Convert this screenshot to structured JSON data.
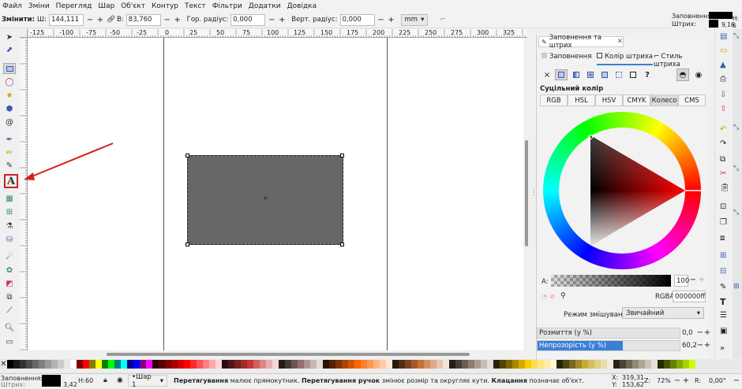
{
  "menu": [
    "Файл",
    "Зміни",
    "Перегляд",
    "Шар",
    "Об'єкт",
    "Контур",
    "Текст",
    "Фільтри",
    "Додатки",
    "Довідка"
  ],
  "toolbar": {
    "change_label": "Змінити:",
    "w_label": "Ш:",
    "w_value": "144,111",
    "h_label": "В:",
    "h_value": "83,760",
    "rx_label": "Гор. радіус:",
    "rx_value": "0,000",
    "ry_label": "Верт. радіус:",
    "ry_value": "0,000",
    "unit": "mm"
  },
  "fs_mini": {
    "fill_label": "Заповнення:",
    "stroke_label": "Штрих:",
    "stroke_width": "9,16",
    "h_label": "Н: 6"
  },
  "ruler_labels": [
    "-125",
    "-100",
    "-75",
    "-50",
    "-25",
    "0",
    "25",
    "50",
    "75",
    "100",
    "125",
    "150",
    "175",
    "200",
    "225",
    "250",
    "275",
    "300",
    "325"
  ],
  "dock": {
    "panel_tab": "Заповнення та штрих",
    "tabs": [
      "Заповнення",
      "Колір штриха",
      "Стиль штриха"
    ],
    "solid_label": "Суцільний колір",
    "modes": [
      "RGB",
      "HSL",
      "HSV",
      "CMYK",
      "Колесо",
      "CMS"
    ],
    "active_mode": "Колесо",
    "alpha_label": "A:",
    "alpha_value": "100",
    "rgba_label": "RGBA:",
    "rgba_value": "000000ff",
    "blend_label": "Режим змішування:",
    "blend_value": "Звичайний",
    "blur_label": "Розмиття (у %)",
    "blur_value": "0,0",
    "opacity_label": "Непрозорість (у %)",
    "opacity_value": "60,2",
    "opacity_fraction": 0.602
  },
  "status": {
    "fill_label": "Заповнення:",
    "stroke_label": "Штрих:",
    "stroke_value": "3,42",
    "h_label": "Н:",
    "h_value": "60",
    "layer": "•Шар 1",
    "message_b1": "Перетягування",
    "message_t1": " малює прямокутник. ",
    "message_b2": "Перетягування ручок",
    "message_t2": " змінює розмір та округляє кути. ",
    "message_b3": "Клацання",
    "message_t3": " позначає об'єкт.",
    "x_label": "X:",
    "x_value": "319,31",
    "y_label": "Y:",
    "y_value": "153,62",
    "z_label": "Z:",
    "zoom": "72%",
    "r_label": "R:",
    "rotation": "0,00°"
  },
  "colors": {
    "rect_fill": "#666666",
    "highlight": "#cc2222",
    "accent": "#3a7fd6"
  },
  "palette": [
    "#000000",
    "#1a1a1a",
    "#333333",
    "#4d4d4d",
    "#666666",
    "#808080",
    "#999999",
    "#b3b3b3",
    "#cccccc",
    "#e6e6e6",
    "#ffffff",
    "#800000",
    "#ff0000",
    "#808000",
    "#ffff00",
    "#008000",
    "#00ff00",
    "#008080",
    "#00ffff",
    "#000080",
    "#0000ff",
    "#800080",
    "#ff00ff",
    "#2b0000",
    "#550000",
    "#800000",
    "#aa0000",
    "#d40000",
    "#ff0000",
    "#ff2a2a",
    "#ff5555",
    "#ff8080",
    "#ffaaaa",
    "#ffd5d5",
    "#280b0b",
    "#501616",
    "#782121",
    "#a02c2c",
    "#c83737",
    "#d35f5f",
    "#de8787",
    "#e9afaf",
    "#f4d7d7",
    "#241c1c",
    "#483737",
    "#6c5353",
    "#916f6f",
    "#ac9393",
    "#c8b7b7",
    "#e3dbdb",
    "#2b1100",
    "#552200",
    "#803300",
    "#aa4400",
    "#d45500",
    "#ff6600",
    "#ff7f2a",
    "#ff9955",
    "#ffb380",
    "#ffccaa",
    "#ffe6d5",
    "#28170b",
    "#502d16",
    "#784421",
    "#a05a2c",
    "#c87137",
    "#d38d5f",
    "#deaa87",
    "#e9c6af",
    "#f4e3d7",
    "#241f1c",
    "#483e37",
    "#6c5d53",
    "#917c6f",
    "#ac9d93",
    "#c8beb7",
    "#e3dedb",
    "#2b2200",
    "#554400",
    "#806600",
    "#aa8800",
    "#d4aa00",
    "#ffcc00",
    "#ffdd55",
    "#ffe680",
    "#ffeeaa",
    "#fff6d5",
    "#28220b",
    "#504416",
    "#786721",
    "#a0892c",
    "#c8ab37",
    "#d4bf5f",
    "#dfd087",
    "#e9ddaf",
    "#f4eed7",
    "#24221c",
    "#484537",
    "#6c6753",
    "#918a6f",
    "#aca793",
    "#c8c4b7",
    "#e3e2db",
    "#222b00",
    "#445500",
    "#668000",
    "#88aa00",
    "#aad400",
    "#ccff00"
  ]
}
